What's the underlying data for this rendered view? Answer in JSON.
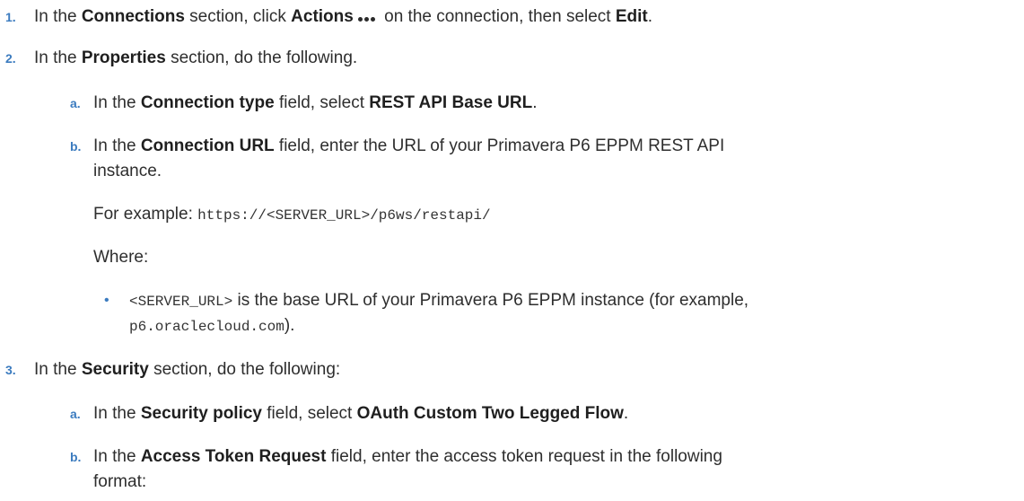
{
  "steps": [
    {
      "num": "1.",
      "s1": "In the ",
      "b1": "Connections",
      "s2": " section, click ",
      "b2": "Actions",
      "s3": " on the connection, then select ",
      "b3": "Edit",
      "s4": "."
    },
    {
      "num": "2.",
      "s1": "In the ",
      "b1": "Properties",
      "s2": " section, do the following.",
      "subs": [
        {
          "letter": "a.",
          "s1": "In the ",
          "b1": "Connection type",
          "s2": " field, select ",
          "b2": "REST API Base URL",
          "s3": "."
        },
        {
          "letter": "b.",
          "s1": "In the ",
          "b1": "Connection URL",
          "s2": " field, enter the URL of your Primavera P6 EPPM REST API",
          "line2": "instance.",
          "example_label": "For example: ",
          "example_code": "https://<SERVER_URL>/p6ws/restapi/",
          "where": "Where:",
          "bullet_code": "<SERVER_URL>",
          "bullet_text": " is the base URL of your Primavera P6 EPPM instance (for example,",
          "bullet_code2": "p6.oraclecloud.com",
          "bullet_end": ")."
        }
      ]
    },
    {
      "num": "3.",
      "s1": "In the ",
      "b1": "Security",
      "s2": " section, do the following:",
      "subs": [
        {
          "letter": "a.",
          "s1": "In the ",
          "b1": "Security policy",
          "s2": " field, select ",
          "b2": "OAuth Custom Two Legged Flow",
          "s3": "."
        },
        {
          "letter": "b.",
          "s1": "In the ",
          "b1": "Access Token Request",
          "s2": " field, enter the access token request in the following",
          "line2": "format:"
        }
      ]
    }
  ]
}
